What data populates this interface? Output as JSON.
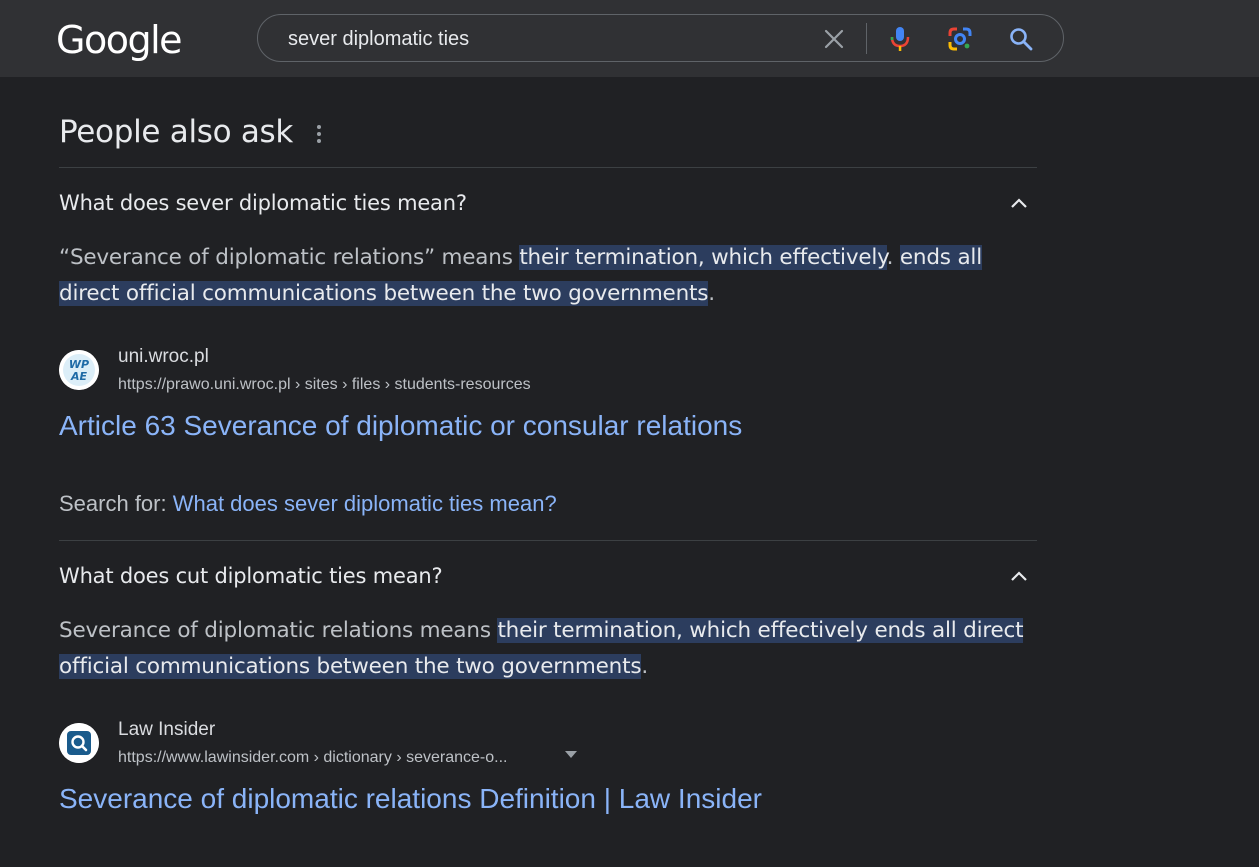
{
  "header": {
    "logo_text": "Google",
    "search_query": "sever diplomatic ties",
    "icons": [
      "close-icon",
      "microphone-icon",
      "google-lens-icon",
      "search-icon"
    ]
  },
  "paa": {
    "title": "People also ask",
    "items": [
      {
        "question": "What does sever diplomatic ties mean?",
        "answer_plain_1": "“Severance of diplomatic relations” means ",
        "answer_hl_1": "their termination, which effectively",
        "answer_plain_2": ". ",
        "answer_hl_2a": "ends all",
        "answer_hl_2b": "direct official communications between the two governments",
        "answer_plain_3": ".",
        "source_name": "uni.wroc.pl",
        "source_url": "https://prawo.uni.wroc.pl › sites › files › students-resources",
        "favicon_text_top": "WP",
        "favicon_text_bottom": "AE",
        "result_title": "Article 63 Severance of diplomatic or consular relations",
        "search_for_label": "Search for: ",
        "search_for_link": "What does sever diplomatic ties mean?"
      },
      {
        "question": "What does cut diplomatic ties mean?",
        "answer_plain_1": "Severance of diplomatic relations means ",
        "answer_hl_1": "their termination, which effectively ends all direct",
        "answer_hl_2": "official communications between the two governments",
        "answer_plain_2": ".",
        "source_name": "Law Insider",
        "source_url": "https://www.lawinsider.com › dictionary › severance-o...",
        "result_title": "Severance of diplomatic relations Definition | Law Insider"
      }
    ]
  },
  "colors": {
    "background": "#202124",
    "header_bg": "#303134",
    "link": "#8ab4f8",
    "highlight": "#2c3d5e"
  }
}
